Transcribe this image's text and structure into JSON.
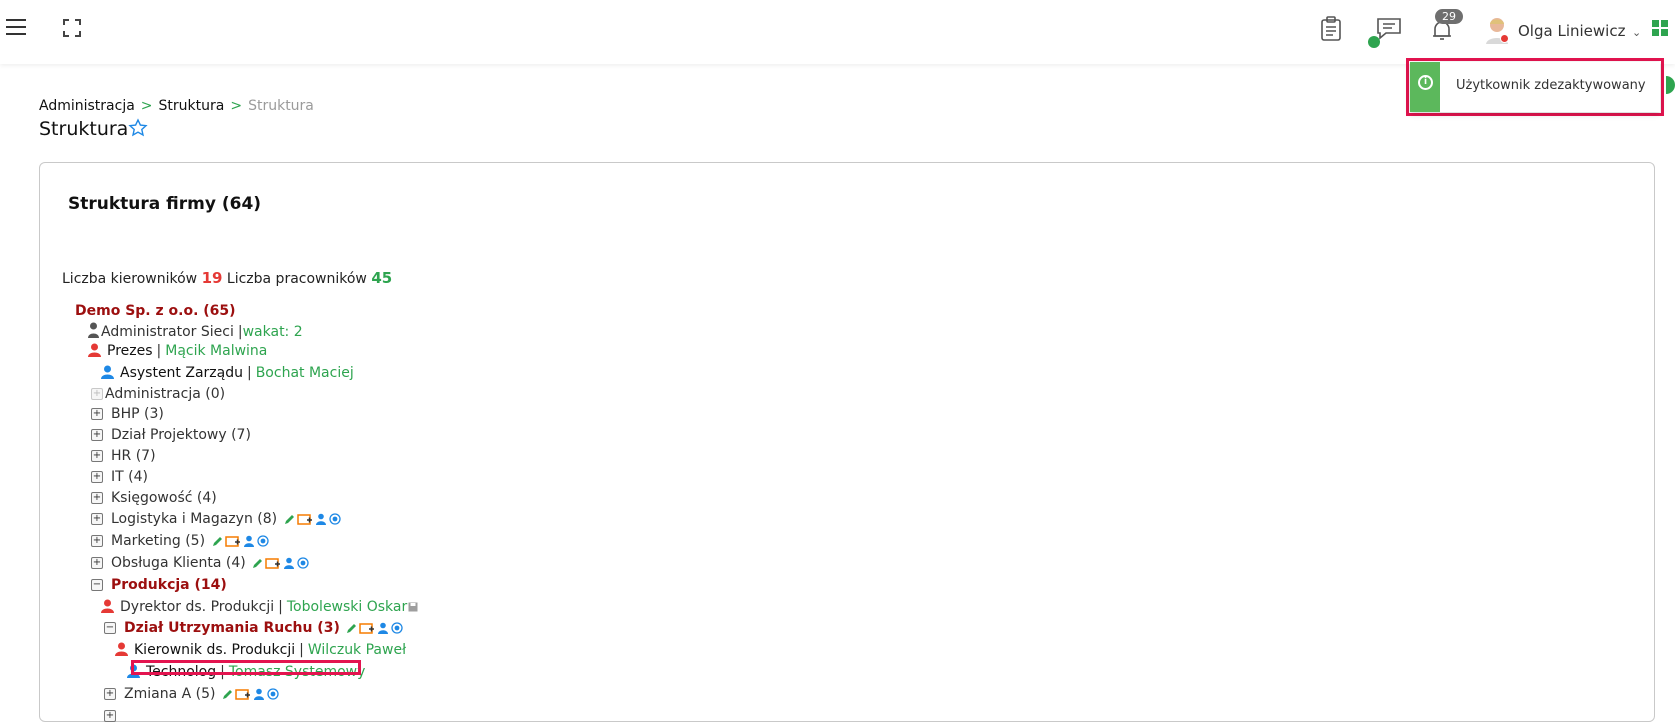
{
  "header": {
    "notifications_count": "29",
    "user_name": "Olga Liniewicz",
    "user_caret": "⌄"
  },
  "toast": {
    "message": "Użytkownik zdezaktywowany",
    "info_glyph": "i"
  },
  "breadcrumb": {
    "items": [
      "Administracja",
      "Struktura",
      "Struktura"
    ],
    "separator": ">"
  },
  "page": {
    "title": "Struktura"
  },
  "card": {
    "title": "Struktura firmy (64)",
    "managers_label": "Liczba kierowników",
    "managers_count": "19",
    "employees_label": "Liczba pracowników",
    "employees_count": "45"
  },
  "tree": {
    "root": "Demo Sp. z o.o.  (65)",
    "admin_sieci": {
      "role": "Administrator Sieci",
      "value": "wakat: 2"
    },
    "prezes": {
      "role": "Prezes",
      "person": "Mącik Malwina"
    },
    "asystent": {
      "role": "Asystent Zarządu",
      "person": "Bochat Maciej"
    },
    "departments": [
      {
        "label": "Administracja  (0)"
      },
      {
        "label": "BHP  (3)"
      },
      {
        "label": "Dział Projektowy  (7)"
      },
      {
        "label": "HR  (7)"
      },
      {
        "label": "IT  (4)"
      },
      {
        "label": "Księgowość  (4)"
      },
      {
        "label": "Logistyka i Magazyn  (8)"
      },
      {
        "label": "Marketing  (5)"
      },
      {
        "label": "Obsługa Klienta  (4)"
      }
    ],
    "produkcja": {
      "label": "Produkcja  (14)"
    },
    "dyrektor": {
      "role": "Dyrektor ds. Produkcji",
      "person": "Tobolewski Oskar"
    },
    "dzial_ur": {
      "label": "Dział Utrzymania Ruchu  (3)"
    },
    "kierownik": {
      "role": "Kierownik ds. Produkcji",
      "person": "Wilczuk Paweł"
    },
    "technolog": {
      "role": "Technolog",
      "person": "Tomasz Systemowy"
    },
    "zmiana_a": {
      "label": "Zmiana A  (5)"
    }
  },
  "colors": {
    "accent_green": "#2ea44f",
    "dark_red": "#9c0f0f",
    "highlight": "#e3144f",
    "manager_icon": "#e53935",
    "employee_icon": "#1e88e5"
  },
  "icons": [
    "menu-icon",
    "fullscreen-icon",
    "clipboard-icon",
    "chat-icon",
    "bell-icon",
    "apps-icon",
    "star-icon",
    "info-icon",
    "pencil-icon",
    "add-unit-icon",
    "add-person-icon",
    "target-icon",
    "save-icon"
  ]
}
